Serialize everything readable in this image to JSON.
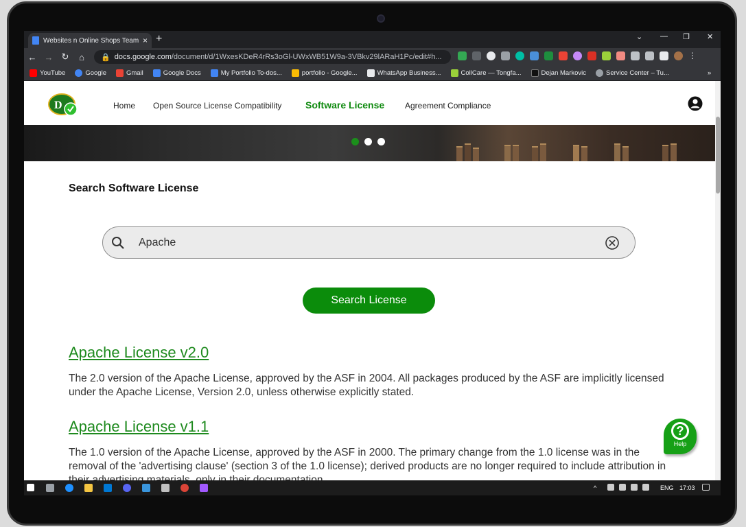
{
  "browser": {
    "tab_title": "Websites n Online Shops Team -",
    "tab_close": "×",
    "new_tab": "+",
    "url_host": "docs.google.com",
    "url_path": "/document/d/1WxesKDeR4rRs3oGl-UWxWB51W9a-3VBkv29lARaH1Pc/edit#h...",
    "bookmarks": [
      {
        "label": "YouTube",
        "color": "#ff0000"
      },
      {
        "label": "Google",
        "color": "#4285f4"
      },
      {
        "label": "Gmail",
        "color": "#ea4335"
      },
      {
        "label": "Google Docs",
        "color": "#4285f4"
      },
      {
        "label": "My Portfolio To-dos...",
        "color": "#4285f4"
      },
      {
        "label": "portfolio - Google...",
        "color": "#fbbc04"
      },
      {
        "label": "WhatsApp Business...",
        "color": "#e8eaed"
      },
      {
        "label": "CollCare — Tongfa...",
        "color": "#9bd13a"
      },
      {
        "label": "Dejan Markovic",
        "color": "#111111"
      },
      {
        "label": "Service Center – Tu...",
        "color": "#9aa0a6"
      }
    ],
    "bookmarks_more": "»"
  },
  "site": {
    "nav": {
      "home": "Home",
      "oss": "Open Source License Compatibility",
      "software_license": "Software License",
      "agreement": "Agreement Compliance"
    },
    "search": {
      "title": "Search Software License",
      "value": "Apache",
      "button": "Search License"
    },
    "results": [
      {
        "title": "Apache License v2.0",
        "description": "The 2.0 version of the Apache License, approved by the ASF in 2004. All packages produced by the ASF are implicitly licensed under the Apache License, Version 2.0, unless otherwise explicitly stated."
      },
      {
        "title": "Apache License v1.1",
        "description": "The 1.0 version of the Apache License, approved by the ASF in 2000. The primary change from the 1.0 license was in the removal of the 'advertising clause' (section 3 of the 1.0 license); derived products are no longer required to include attribution in their advertising materials, only in their documentation."
      }
    ],
    "help": {
      "icon": "?",
      "label": "Help"
    },
    "carousel": {
      "slides": 3,
      "active": 1
    },
    "accent_color": "#0b8c0b"
  },
  "taskbar": {
    "language": "ENG",
    "time": "17:03"
  }
}
